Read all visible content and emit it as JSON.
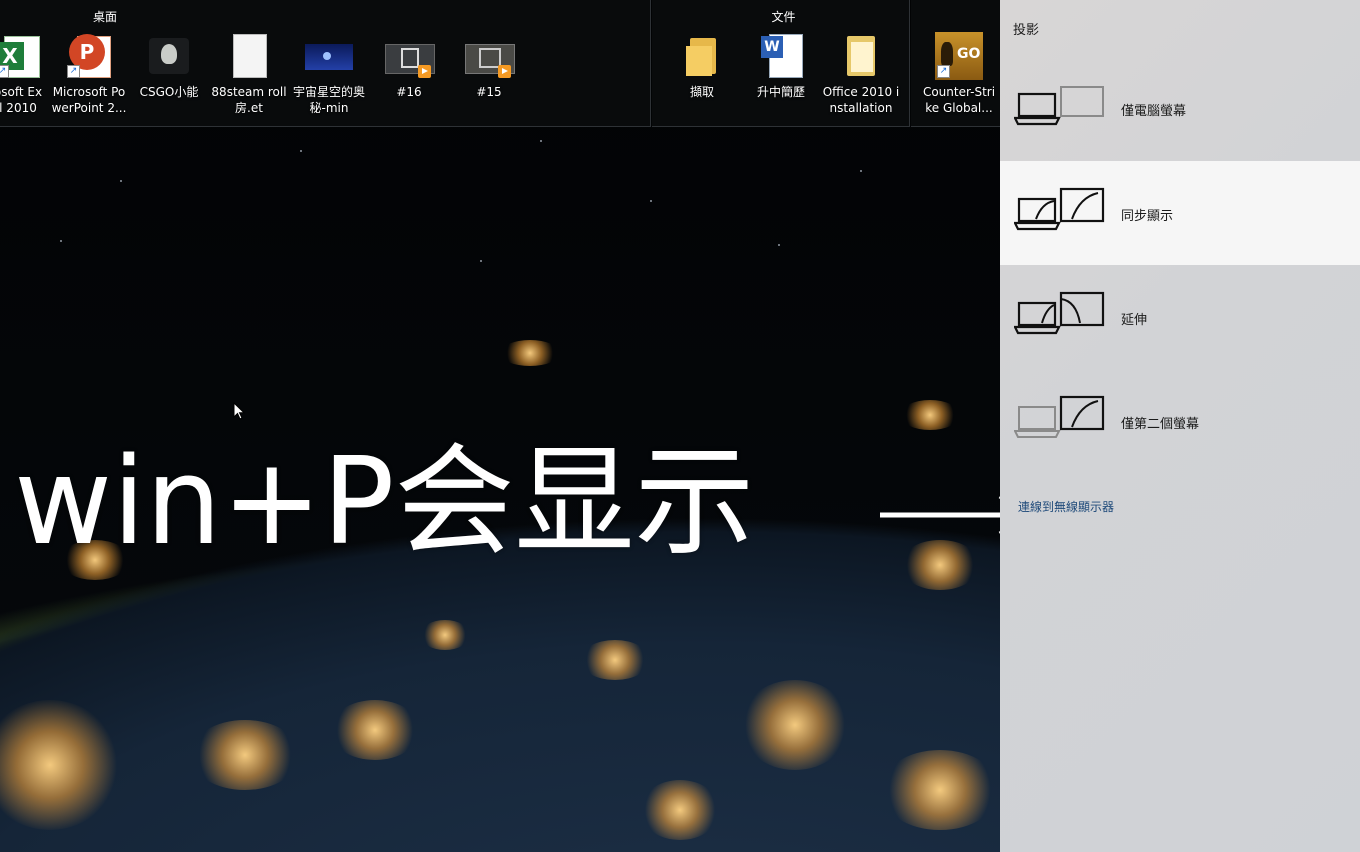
{
  "desktop": {
    "group_desktop": {
      "title": "桌面",
      "items": [
        {
          "label": "osoft Ex\nl 2010",
          "icon": "excel-icon"
        },
        {
          "label": "Microsoft Po\nwerPoint 2...",
          "icon": "powerpoint-icon"
        },
        {
          "label": "CSGO小能",
          "icon": "csgo-icon"
        },
        {
          "label": "88steam roll\n房.et",
          "icon": "file-icon"
        },
        {
          "label": "宇宙星空的奥\n秘-min",
          "icon": "image-icon"
        },
        {
          "label": "#16",
          "icon": "video-icon"
        },
        {
          "label": "#15",
          "icon": "video-icon"
        }
      ]
    },
    "group_files": {
      "title": "文件",
      "items": [
        {
          "label": "擷取",
          "icon": "folder-icon"
        },
        {
          "label": "升中簡歷",
          "icon": "word-icon"
        },
        {
          "label": "Office 2010 i\nnstallation",
          "icon": "folder-icon"
        },
        {
          "label": "Counter-Stri\nke Global...",
          "icon": "csgo-game-icon"
        }
      ]
    }
  },
  "overlay": {
    "text": "win+P会显示"
  },
  "project_panel": {
    "title": "投影",
    "options": [
      {
        "label": "僅電腦螢幕",
        "selected": false
      },
      {
        "label": "同步顯示",
        "selected": true
      },
      {
        "label": "延伸",
        "selected": false
      },
      {
        "label": "僅第二個螢幕",
        "selected": false
      }
    ],
    "wireless_link": "連線到無線顯示器"
  }
}
